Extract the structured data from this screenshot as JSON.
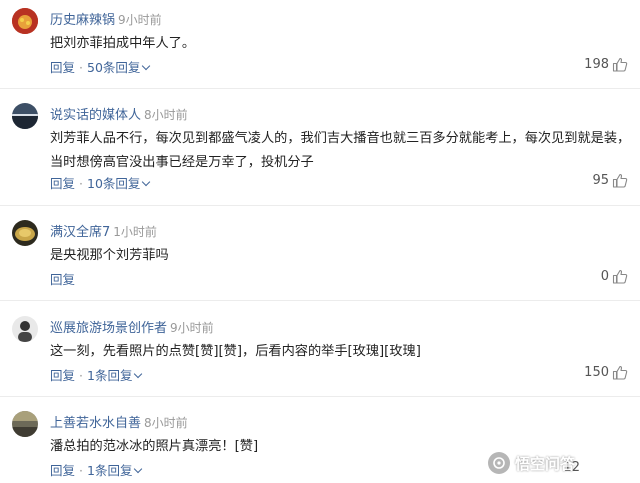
{
  "comments": [
    {
      "name": "历史麻辣锅",
      "time": "9小时前",
      "text": [
        "把刘亦菲拍成中年人了。"
      ],
      "reply_label": "回复",
      "replies_label": "50条回复",
      "likes": "198"
    },
    {
      "name": "说实话的媒体人",
      "time": "8小时前",
      "text": [
        "刘芳菲人品不行，每次见到都盛气凌人的，我们吉大播音也就三百多分就能考上，每次见到就是装，",
        "当时想傍高官没出事已经是万幸了，投机分子"
      ],
      "reply_label": "回复",
      "replies_label": "10条回复",
      "likes": "95"
    },
    {
      "name": "满汉全席7",
      "time": "1小时前",
      "text": [
        "是央视那个刘芳菲吗"
      ],
      "reply_label": "回复",
      "replies_label": "",
      "likes": "0"
    },
    {
      "name": "巡展旅游场景创作者",
      "time": "9小时前",
      "text": [
        "这一刻，先看照片的点赞[赞][赞]，后看内容的举手[玫瑰][玫瑰]"
      ],
      "reply_label": "回复",
      "replies_label": "1条回复",
      "likes": "150"
    },
    {
      "name": "上善若水水自善",
      "time": "8小时前",
      "text": [
        "潘总拍的范冰冰的照片真漂亮！[赞]"
      ],
      "reply_label": "回复",
      "replies_label": "1条回复",
      "likes": "12"
    }
  ],
  "watermark": "悟空问答",
  "colors": {
    "link": "#406599",
    "muted": "#999999",
    "divider": "#ececec"
  }
}
